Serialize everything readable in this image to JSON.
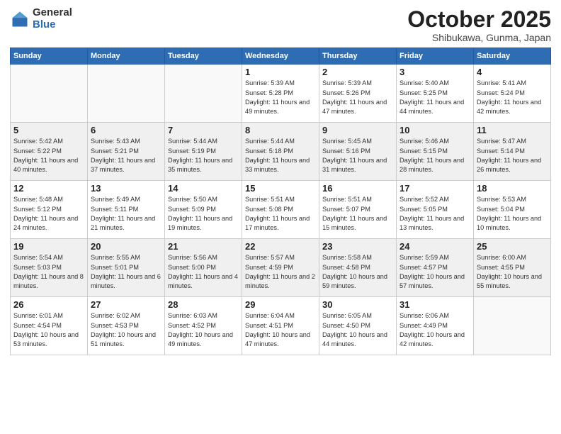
{
  "header": {
    "logo_general": "General",
    "logo_blue": "Blue",
    "month_title": "October 2025",
    "subtitle": "Shibukawa, Gunma, Japan"
  },
  "days_of_week": [
    "Sunday",
    "Monday",
    "Tuesday",
    "Wednesday",
    "Thursday",
    "Friday",
    "Saturday"
  ],
  "weeks": [
    {
      "gray": false,
      "cells": [
        {
          "day": "",
          "info": ""
        },
        {
          "day": "",
          "info": ""
        },
        {
          "day": "",
          "info": ""
        },
        {
          "day": "1",
          "info": "Sunrise: 5:39 AM\nSunset: 5:28 PM\nDaylight: 11 hours\nand 49 minutes."
        },
        {
          "day": "2",
          "info": "Sunrise: 5:39 AM\nSunset: 5:26 PM\nDaylight: 11 hours\nand 47 minutes."
        },
        {
          "day": "3",
          "info": "Sunrise: 5:40 AM\nSunset: 5:25 PM\nDaylight: 11 hours\nand 44 minutes."
        },
        {
          "day": "4",
          "info": "Sunrise: 5:41 AM\nSunset: 5:24 PM\nDaylight: 11 hours\nand 42 minutes."
        }
      ]
    },
    {
      "gray": true,
      "cells": [
        {
          "day": "5",
          "info": "Sunrise: 5:42 AM\nSunset: 5:22 PM\nDaylight: 11 hours\nand 40 minutes."
        },
        {
          "day": "6",
          "info": "Sunrise: 5:43 AM\nSunset: 5:21 PM\nDaylight: 11 hours\nand 37 minutes."
        },
        {
          "day": "7",
          "info": "Sunrise: 5:44 AM\nSunset: 5:19 PM\nDaylight: 11 hours\nand 35 minutes."
        },
        {
          "day": "8",
          "info": "Sunrise: 5:44 AM\nSunset: 5:18 PM\nDaylight: 11 hours\nand 33 minutes."
        },
        {
          "day": "9",
          "info": "Sunrise: 5:45 AM\nSunset: 5:16 PM\nDaylight: 11 hours\nand 31 minutes."
        },
        {
          "day": "10",
          "info": "Sunrise: 5:46 AM\nSunset: 5:15 PM\nDaylight: 11 hours\nand 28 minutes."
        },
        {
          "day": "11",
          "info": "Sunrise: 5:47 AM\nSunset: 5:14 PM\nDaylight: 11 hours\nand 26 minutes."
        }
      ]
    },
    {
      "gray": false,
      "cells": [
        {
          "day": "12",
          "info": "Sunrise: 5:48 AM\nSunset: 5:12 PM\nDaylight: 11 hours\nand 24 minutes."
        },
        {
          "day": "13",
          "info": "Sunrise: 5:49 AM\nSunset: 5:11 PM\nDaylight: 11 hours\nand 21 minutes."
        },
        {
          "day": "14",
          "info": "Sunrise: 5:50 AM\nSunset: 5:09 PM\nDaylight: 11 hours\nand 19 minutes."
        },
        {
          "day": "15",
          "info": "Sunrise: 5:51 AM\nSunset: 5:08 PM\nDaylight: 11 hours\nand 17 minutes."
        },
        {
          "day": "16",
          "info": "Sunrise: 5:51 AM\nSunset: 5:07 PM\nDaylight: 11 hours\nand 15 minutes."
        },
        {
          "day": "17",
          "info": "Sunrise: 5:52 AM\nSunset: 5:05 PM\nDaylight: 11 hours\nand 13 minutes."
        },
        {
          "day": "18",
          "info": "Sunrise: 5:53 AM\nSunset: 5:04 PM\nDaylight: 11 hours\nand 10 minutes."
        }
      ]
    },
    {
      "gray": true,
      "cells": [
        {
          "day": "19",
          "info": "Sunrise: 5:54 AM\nSunset: 5:03 PM\nDaylight: 11 hours\nand 8 minutes."
        },
        {
          "day": "20",
          "info": "Sunrise: 5:55 AM\nSunset: 5:01 PM\nDaylight: 11 hours\nand 6 minutes."
        },
        {
          "day": "21",
          "info": "Sunrise: 5:56 AM\nSunset: 5:00 PM\nDaylight: 11 hours\nand 4 minutes."
        },
        {
          "day": "22",
          "info": "Sunrise: 5:57 AM\nSunset: 4:59 PM\nDaylight: 11 hours\nand 2 minutes."
        },
        {
          "day": "23",
          "info": "Sunrise: 5:58 AM\nSunset: 4:58 PM\nDaylight: 10 hours\nand 59 minutes."
        },
        {
          "day": "24",
          "info": "Sunrise: 5:59 AM\nSunset: 4:57 PM\nDaylight: 10 hours\nand 57 minutes."
        },
        {
          "day": "25",
          "info": "Sunrise: 6:00 AM\nSunset: 4:55 PM\nDaylight: 10 hours\nand 55 minutes."
        }
      ]
    },
    {
      "gray": false,
      "cells": [
        {
          "day": "26",
          "info": "Sunrise: 6:01 AM\nSunset: 4:54 PM\nDaylight: 10 hours\nand 53 minutes."
        },
        {
          "day": "27",
          "info": "Sunrise: 6:02 AM\nSunset: 4:53 PM\nDaylight: 10 hours\nand 51 minutes."
        },
        {
          "day": "28",
          "info": "Sunrise: 6:03 AM\nSunset: 4:52 PM\nDaylight: 10 hours\nand 49 minutes."
        },
        {
          "day": "29",
          "info": "Sunrise: 6:04 AM\nSunset: 4:51 PM\nDaylight: 10 hours\nand 47 minutes."
        },
        {
          "day": "30",
          "info": "Sunrise: 6:05 AM\nSunset: 4:50 PM\nDaylight: 10 hours\nand 44 minutes."
        },
        {
          "day": "31",
          "info": "Sunrise: 6:06 AM\nSunset: 4:49 PM\nDaylight: 10 hours\nand 42 minutes."
        },
        {
          "day": "",
          "info": ""
        }
      ]
    }
  ]
}
